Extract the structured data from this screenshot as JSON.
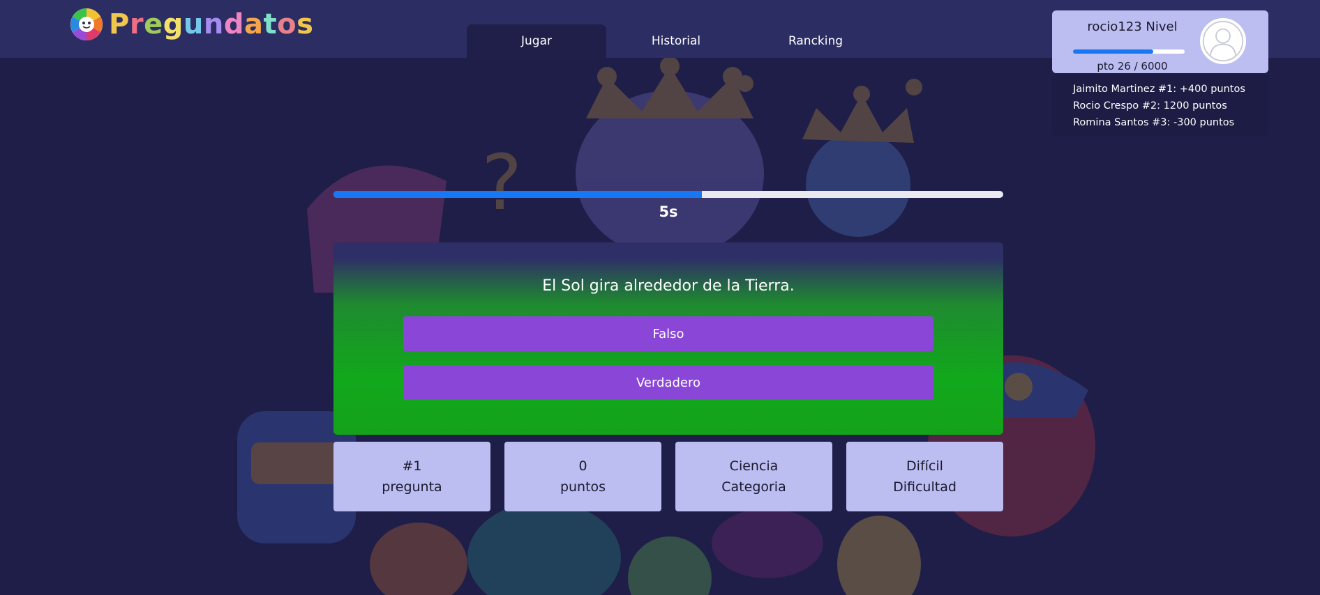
{
  "app": {
    "logo_text": "Pregundatos"
  },
  "nav": {
    "tabs": [
      {
        "label": "Jugar",
        "active": true
      },
      {
        "label": "Historial",
        "active": false
      },
      {
        "label": "Rancking",
        "active": false
      }
    ]
  },
  "user": {
    "name_level": "rocio123 Nivel",
    "points_text": "pto 26 / 6000",
    "progress_fraction": 0.72,
    "avatar_icon": "user-silhouette-icon"
  },
  "ranking": [
    "Jaimito Martinez #1: +400 puntos",
    "Rocio Crespo #2: 1200 puntos",
    "Romina Santos #3: -300 puntos"
  ],
  "timer": {
    "label": "5s",
    "fraction_remaining": 0.55
  },
  "question": {
    "text": "El Sol gira alrededor de la Tierra.",
    "answers": [
      "Falso",
      "Verdadero"
    ]
  },
  "stats": [
    {
      "value": "#1",
      "label": "pregunta"
    },
    {
      "value": "0",
      "label": "puntos"
    },
    {
      "value": "Ciencia",
      "label": "Categoria"
    },
    {
      "value": "Difícil",
      "label": "Dificultad"
    }
  ],
  "colors": {
    "background": "#1e1e48",
    "navbar": "#2c2d63",
    "card": "#bcbdf0",
    "accent_blue": "#1877f2",
    "answer_purple": "#8a46d6",
    "correct_green": "#12a81c"
  }
}
